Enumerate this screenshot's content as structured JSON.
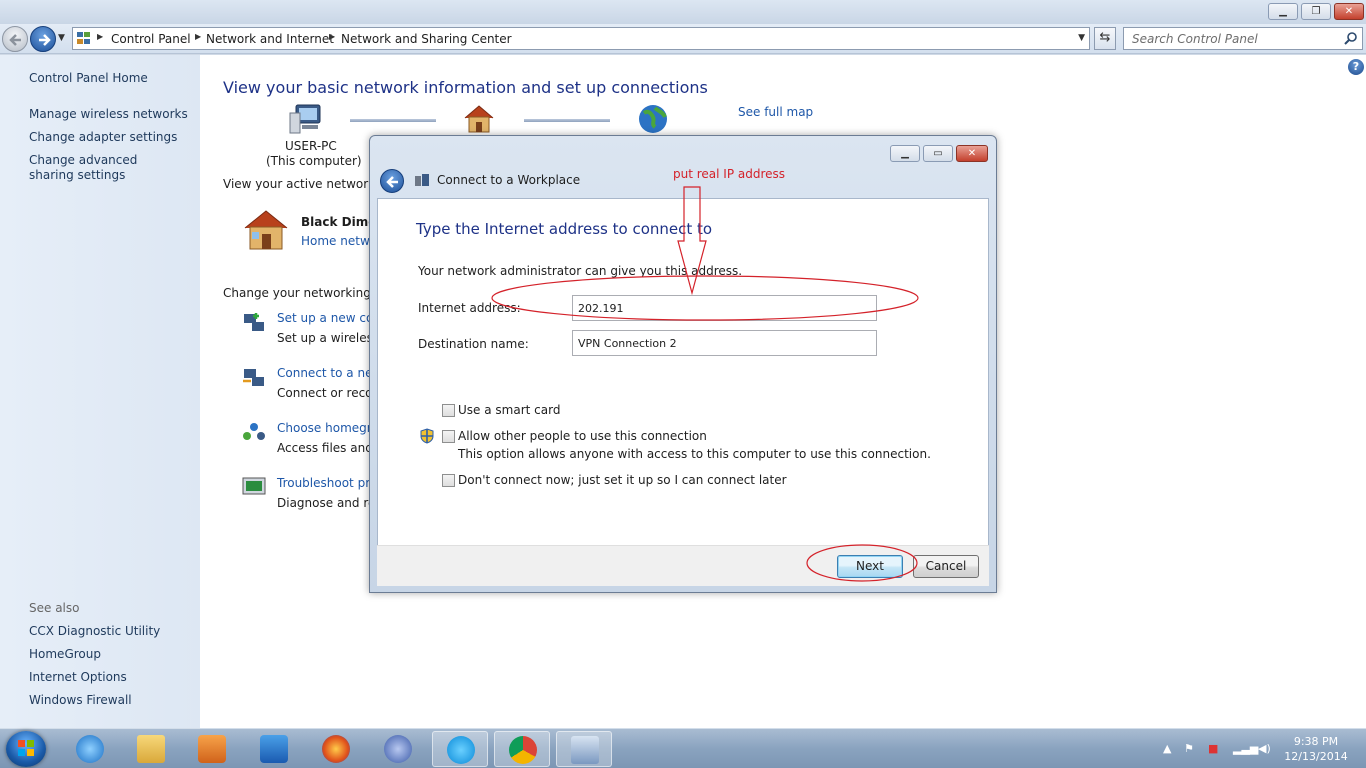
{
  "window": {
    "breadcrumbs": [
      "Control Panel",
      "Network and Internet",
      "Network and Sharing Center"
    ],
    "search_placeholder": "Search Control Panel"
  },
  "sidebar": {
    "home": "Control Panel Home",
    "links": [
      "Manage wireless networks",
      "Change adapter settings",
      "Change advanced sharing settings"
    ],
    "see_also_label": "See also",
    "see_also": [
      "CCX Diagnostic Utility",
      "HomeGroup",
      "Internet Options",
      "Windows Firewall"
    ]
  },
  "main": {
    "title": "View your basic network information and set up connections",
    "computer_name": "USER-PC",
    "computer_sub": "(This computer)",
    "see_full_map": "See full map",
    "active_networks_label": "View your active networks",
    "network_name": "Black Dimon",
    "network_type": "Home netwo",
    "change_settings_label": "Change your networking se",
    "tasks": [
      {
        "title": "Set up a new conn",
        "desc": "Set up a wireless,"
      },
      {
        "title": "Connect to a netw",
        "desc": "Connect or recon"
      },
      {
        "title": "Choose homegro",
        "desc": "Access files and p"
      },
      {
        "title": "Troubleshoot pro",
        "desc": "Diagnose and rep"
      }
    ]
  },
  "dialog": {
    "title": "Connect to a Workplace",
    "heading": "Type the Internet address to connect to",
    "description": "Your network administrator can give you this address.",
    "internet_address_label": "Internet address:",
    "internet_address_value": "202.191",
    "destination_label": "Destination name:",
    "destination_value": "VPN Connection 2",
    "checkbox_smart_card": "Use a smart card",
    "checkbox_allow_others": "Allow other people to use this connection",
    "allow_others_note": "This option allows anyone with access to this computer to use this connection.",
    "checkbox_dont_connect": "Don't connect now; just set it up so I can connect later",
    "next_label": "Next",
    "cancel_label": "Cancel",
    "annotation": "put  real IP address"
  },
  "taskbar": {
    "time": "9:38 PM",
    "date": "12/13/2014",
    "apps": [
      "internet-explorer",
      "file-explorer",
      "media-player",
      "maxthon",
      "firefox",
      "thunderbird",
      "skype",
      "chrome",
      "control-panel"
    ]
  },
  "colors": {
    "link": "#1e57a8",
    "heading": "#1e3287",
    "annotation": "#d4222a"
  }
}
